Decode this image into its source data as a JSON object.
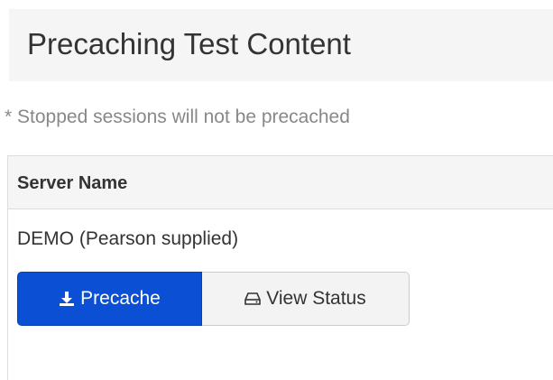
{
  "header": {
    "title": "Precaching Test Content"
  },
  "note": "* Stopped sessions will not be precached",
  "table": {
    "columns": [
      "Server Name"
    ],
    "rows": [
      {
        "server_name": "DEMO (Pearson supplied)"
      }
    ]
  },
  "actions": {
    "precache_label": "Precache",
    "precache_icon": "download-icon",
    "view_status_label": "View Status",
    "view_status_icon": "hdd-icon"
  },
  "colors": {
    "primary": "#0a4fd4",
    "header_bg": "#f5f5f5",
    "muted_text": "#888888"
  }
}
